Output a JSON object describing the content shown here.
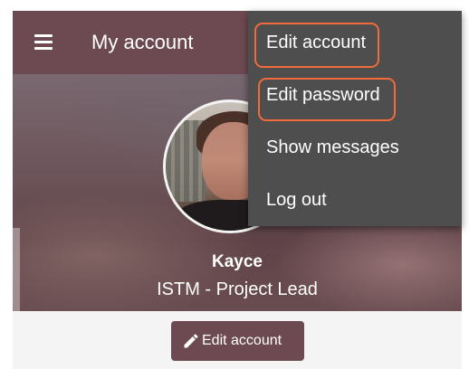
{
  "app_bar": {
    "title": "My account",
    "menu_icon": "hamburger-menu-icon",
    "color": "#6d4a52"
  },
  "profile": {
    "avatar": "user-avatar-photo",
    "name": "Kayce",
    "role": "ISTM - Project Lead"
  },
  "actions": {
    "edit_account_label": "Edit account",
    "edit_icon": "pencil-icon"
  },
  "menu": {
    "items": [
      {
        "label": "Edit account"
      },
      {
        "label": "Edit password"
      },
      {
        "label": "Show messages"
      },
      {
        "label": "Log out"
      }
    ],
    "background": "#4e4e4e"
  },
  "annotation": {
    "color": "#f26b3a"
  }
}
